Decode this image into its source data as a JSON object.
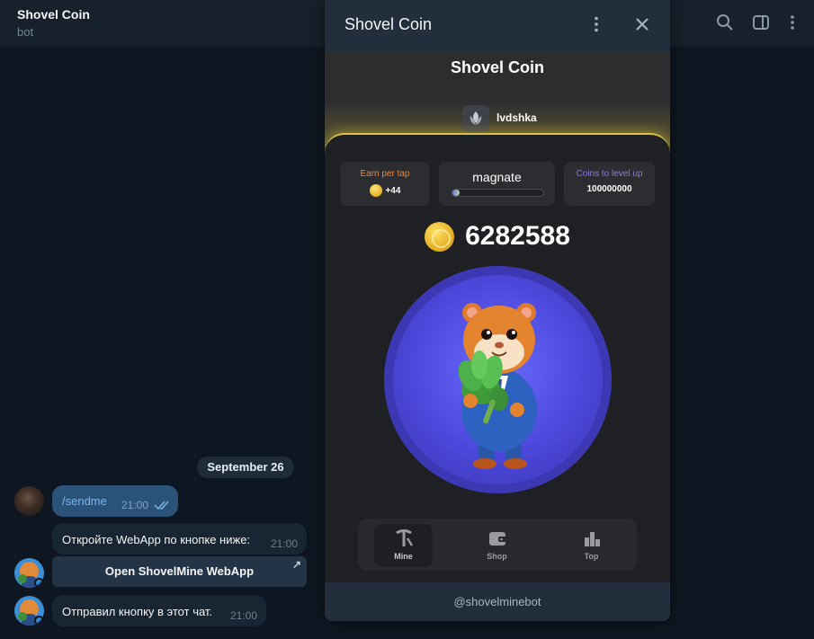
{
  "chat": {
    "title": "Shovel Coin",
    "subtitle": "bot",
    "date_separator": "September 26",
    "messages": [
      {
        "text": "/sendme",
        "time": "21:00"
      },
      {
        "text": "Откройте WebApp по кнопке ниже:",
        "time": "21:00"
      },
      {
        "text": "Отправил кнопку в этот чат.",
        "time": "21:00"
      }
    ],
    "inline_button": {
      "label": "Open ShovelMine WebApp",
      "arrow": "↗"
    }
  },
  "miniapp": {
    "window_title": "Shovel Coin",
    "app_title": "Shovel Coin",
    "username": "lvdshka",
    "stats": {
      "earn_per_tap_label": "Earn per tap",
      "earn_per_tap_value": "+44",
      "rank_name": "magnate",
      "rank_progress": 0.08,
      "coins_to_level_label": "Coins to level up",
      "coins_to_level_value": "100000000"
    },
    "balance": "6282588",
    "nav": [
      {
        "label": "Mine",
        "icon": "pickaxe-icon",
        "active": true
      },
      {
        "label": "Shop",
        "icon": "wallet-icon",
        "active": false
      },
      {
        "label": "Top",
        "icon": "bar-chart-icon",
        "active": false
      }
    ],
    "footer_handle": "@shovelminebot"
  },
  "colors": {
    "accent_gold": "#d9c23f",
    "earn_label": "#e8893a",
    "level_label": "#8c7bd9",
    "tap_circle": "#3c38b4",
    "outgoing_bubble": "#2b5278"
  }
}
